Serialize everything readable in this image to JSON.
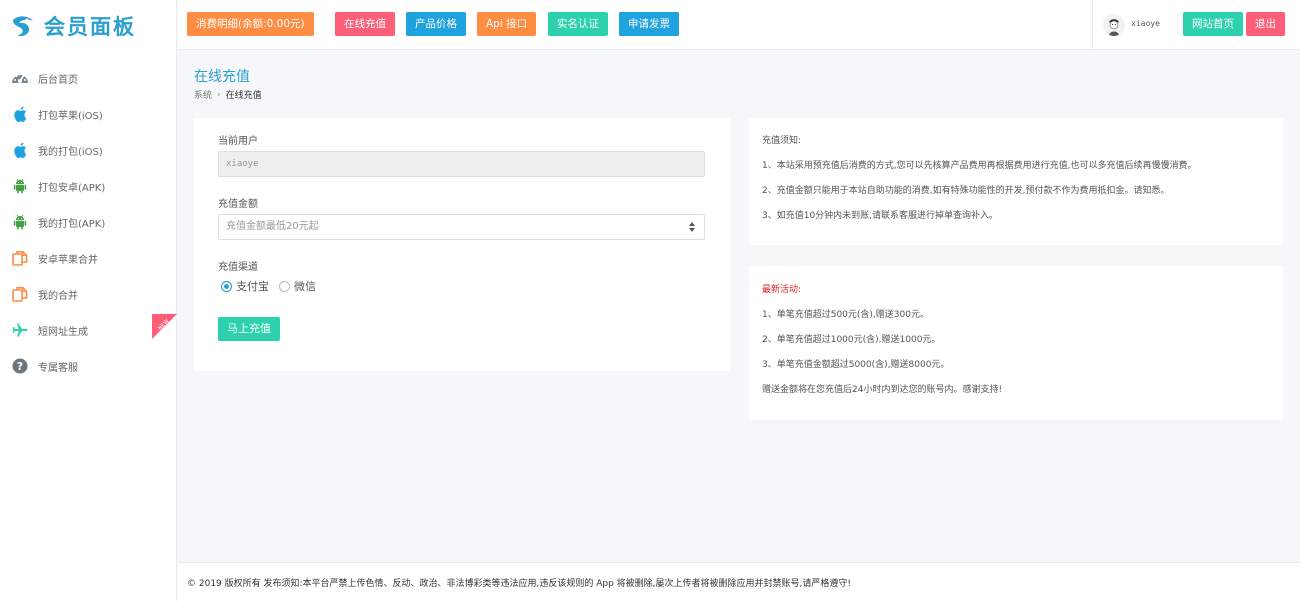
{
  "brand": {
    "name": "会员面板"
  },
  "sidebar": {
    "items": [
      {
        "label": "后台首页",
        "icon": "dashboard-icon"
      },
      {
        "label": "打包苹果(iOS)",
        "icon": "apple-icon"
      },
      {
        "label": "我的打包(iOS)",
        "icon": "apple-icon"
      },
      {
        "label": "打包安卓(APK)",
        "icon": "android-icon"
      },
      {
        "label": "我的打包(APK)",
        "icon": "android-icon"
      },
      {
        "label": "安卓苹果合并",
        "icon": "copy-icon"
      },
      {
        "label": "我的合并",
        "icon": "copy-icon"
      },
      {
        "label": "短网址生成",
        "icon": "plane-icon",
        "badge": "NEW"
      },
      {
        "label": "专属客服",
        "icon": "question-icon"
      }
    ]
  },
  "topbar": {
    "buttons": [
      {
        "label": "消费明细(余额:0.00元)",
        "color": "#fe8c42"
      },
      {
        "label": "在线充值",
        "color": "#ff5e79"
      },
      {
        "label": "产品价格",
        "color": "#1fa2dd"
      },
      {
        "label": "Api 接口",
        "color": "#fe8c42"
      },
      {
        "label": "实名认证",
        "color": "#2ed1ad"
      },
      {
        "label": "申请发票",
        "color": "#1fa2dd"
      }
    ],
    "username": "xiaoye",
    "home_label": "网站首页",
    "logout_label": "退出"
  },
  "page": {
    "title": "在线充值",
    "breadcrumb": [
      "系统",
      "在线充值"
    ]
  },
  "form": {
    "user_label": "当前用户",
    "user_value": "xiaoye",
    "amount_label": "充值金额",
    "amount_placeholder": "充值金额最低20元起",
    "channel_label": "充值渠道",
    "channels": [
      "支付宝",
      "微信"
    ],
    "selected_channel": "支付宝",
    "submit_label": "马上充值"
  },
  "notice": {
    "title": "充值须知:",
    "lines": [
      "1、本站采用预充值后消费的方式,您可以先核算产品费用再根据费用进行充值,也可以多充值后续再慢慢消费。",
      "2、充值金额只能用于本站自助功能的消费,如有特殊功能性的开发,预付款不作为费用抵扣金。请知悉。",
      "3、如充值10分钟内未到账,请联系客服进行掉单查询补入。"
    ]
  },
  "promo": {
    "title": "最新活动:",
    "lines": [
      "1、单笔充值超过500元(含),赠送300元。",
      "2、单笔充值超过1000元(含),赠送1000元。",
      "3、单笔充值金额超过5000(含),赠送8000元。",
      "赠送金额将在您充值后24小时内到达您的账号内。感谢支持!"
    ]
  },
  "footer": {
    "text": "© 2019 版权所有 发布须知:本平台严禁上传色情、反动、政治、非法博彩类等违法应用,违反该规则的 App 将被删除,屡次上传者将被删除应用并封禁账号,请严格遵守!"
  },
  "colors": {
    "accent": "#2b9fcf",
    "orange": "#fe8c42",
    "pink": "#ff5e79",
    "blue": "#1fa2dd",
    "green": "#2ed1ad",
    "promo_red": "#e02020"
  }
}
